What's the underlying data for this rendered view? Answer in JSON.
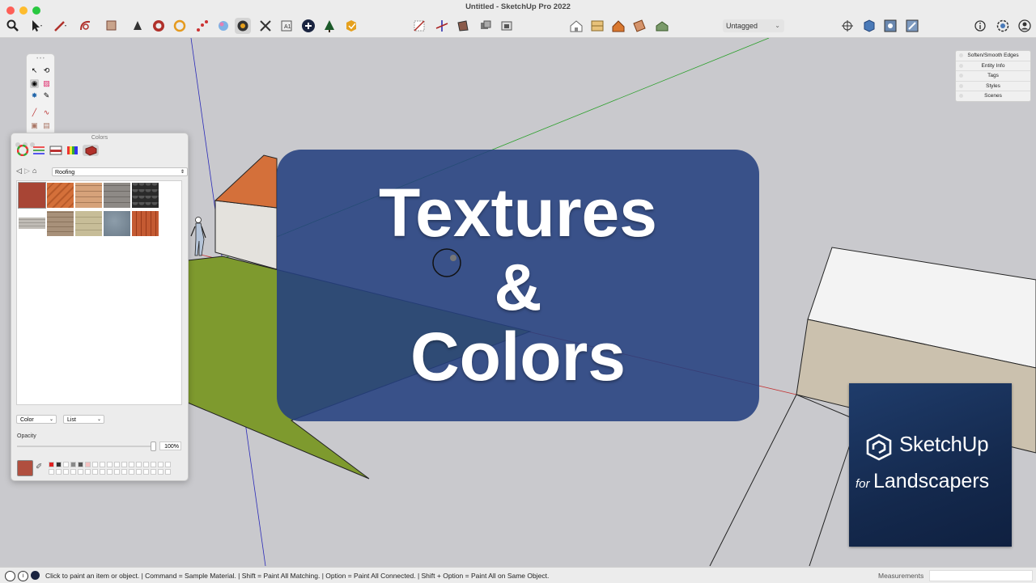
{
  "window": {
    "title": "Untitled - SketchUp Pro 2022"
  },
  "toolbar": {
    "tags_dropdown": "Untagged",
    "icons": [
      "search-icon",
      "select-arrow-icon",
      "line-tool-icon",
      "shapes-icon",
      "push-pull-icon",
      "paint-bucket-icon",
      "orbit-icon",
      "pan-icon",
      "styles-icon",
      "sandbox-icon",
      "zoom-extents-icon",
      "text-icon",
      "add-icon",
      "3d-warehouse-icon",
      "extension-icon",
      "section-icon",
      "axes-icon",
      "box-icon",
      "house-view-icons",
      "info-icon",
      "settings-icon",
      "account-icon"
    ]
  },
  "trays": [
    "Soften/Smooth Edges",
    "Entity Info",
    "Tags",
    "Styles",
    "Scenes"
  ],
  "colors_panel": {
    "title": "Colors",
    "library": "Roofing",
    "swatches": [
      {
        "name": "roofing-red",
        "color": "#a84535"
      },
      {
        "name": "roofing-orange-tile",
        "color": "#d4703a"
      },
      {
        "name": "roofing-shingle-tan",
        "color": "#d6a27a"
      },
      {
        "name": "roofing-slate-gray",
        "color": "#8e8a86"
      },
      {
        "name": "roofing-scallop-dark",
        "color": "#3a3a3a"
      },
      {
        "name": "roofing-light-gray",
        "color": "#c0bcb6"
      },
      {
        "name": "roofing-brown-shingle",
        "color": "#a8917a"
      },
      {
        "name": "roofing-beige-slate",
        "color": "#c7bd98"
      },
      {
        "name": "roofing-blue-slate",
        "color": "#7d8d99"
      },
      {
        "name": "roofing-terracotta",
        "color": "#c45a32"
      }
    ],
    "dropdowns": {
      "mode": "Color",
      "view": "List"
    },
    "opacity_label": "Opacity",
    "opacity_value": "100%",
    "current_color": "#b04f3f"
  },
  "overlay": {
    "line1": "Textures",
    "line2": "&",
    "line3": "Colors"
  },
  "logo": {
    "brand": "SketchUp",
    "for": "for",
    "subtitle": "Landscapers"
  },
  "statusbar": {
    "text": "Click to paint an item or object. | Command = Sample Material. | Shift = Paint All Matching. | Option = Paint All Connected. | Shift + Option = Paint All on Same Object.",
    "measurements_label": "Measurements",
    "measurements_value": ""
  }
}
